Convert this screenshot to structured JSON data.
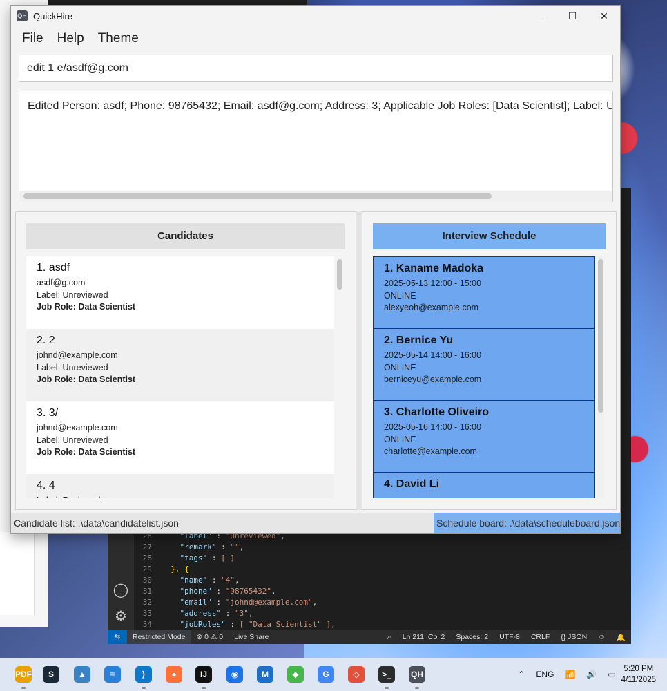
{
  "app": {
    "title": "QuickHire",
    "logo_text": "QH",
    "window_controls": {
      "minimize": "—",
      "maximize": "☐",
      "close": "✕"
    }
  },
  "menu": [
    "File",
    "Help",
    "Theme"
  ],
  "command_input": {
    "value": "edit 1 e/asdf@g.com"
  },
  "result": {
    "text": "Edited Person: asdf; Phone: 98765432; Email: asdf@g.com; Address: 3; Applicable Job Roles: [Data Scientist]; Label: Unreviewed"
  },
  "candidates": {
    "header": "Candidates",
    "items": [
      {
        "name": "1. asdf",
        "email": "asdf@g.com",
        "label": "Label: Unreviewed",
        "job": "Job Role: Data Scientist"
      },
      {
        "name": "2. 2",
        "email": "johnd@example.com",
        "label": "Label: Unreviewed",
        "job": "Job Role: Data Scientist"
      },
      {
        "name": "3. 3/",
        "email": "johnd@example.com",
        "label": "Label: Unreviewed",
        "job": "Job Role: Data Scientist"
      },
      {
        "name": "4. 4",
        "email": "",
        "label": "Label: Reviewed",
        "job": ""
      }
    ]
  },
  "schedule": {
    "header": "Interview Schedule",
    "items": [
      {
        "name": "1. Kaname Madoka",
        "time": "2025-05-13  12:00 - 15:00",
        "mode": "ONLINE",
        "email": "alexyeoh@example.com"
      },
      {
        "name": "2. Bernice Yu",
        "time": "2025-05-14  14:00 - 16:00",
        "mode": "ONLINE",
        "email": "berniceyu@example.com"
      },
      {
        "name": "3. Charlotte Oliveiro",
        "time": "2025-05-16  14:00 - 16:00",
        "mode": "ONLINE",
        "email": "charlotte@example.com"
      },
      {
        "name": "4. David Li",
        "time": "",
        "mode": "",
        "email": ""
      }
    ]
  },
  "status": {
    "left": "Candidate list: .\\data\\candidatelist.json",
    "right": "Schedule board: .\\data\\scheduleboard.json"
  },
  "vscode": {
    "code_lines": [
      {
        "n": "26",
        "key": "\"label\"",
        "val": "\"Unreviewed\"",
        "tail": ","
      },
      {
        "n": "27",
        "key": "\"remark\"",
        "val": "\"\"",
        "tail": ","
      },
      {
        "n": "28",
        "key": "\"tags\"",
        "val": "[ ]",
        "tail": ""
      },
      {
        "n": "29",
        "key": "",
        "val": "}, {",
        "tail": ""
      },
      {
        "n": "30",
        "key": "\"name\"",
        "val": "\"4\"",
        "tail": ","
      },
      {
        "n": "31",
        "key": "\"phone\"",
        "val": "\"98765432\"",
        "tail": ","
      },
      {
        "n": "32",
        "key": "\"email\"",
        "val": "\"johnd@example.com\"",
        "tail": ","
      },
      {
        "n": "33",
        "key": "\"address\"",
        "val": "\"3\"",
        "tail": ","
      },
      {
        "n": "34",
        "key": "\"jobRoles\"",
        "val": "[ \"Data Scientist\" ]",
        "tail": ","
      }
    ],
    "status": {
      "restricted": "Restricted Mode",
      "problems": "⊗ 0 ⚠ 0",
      "liveshare": "Live Share",
      "position": "Ln 211, Col 2",
      "spaces": "Spaces: 2",
      "encoding": "UTF-8",
      "eol": "CRLF",
      "language": "{} JSON"
    }
  },
  "taskbar": {
    "apps": [
      {
        "name": "pdf-app-icon",
        "glyph": "PDF",
        "color": "#e8a100"
      },
      {
        "name": "steam-icon",
        "glyph": "S",
        "color": "#1b2838"
      },
      {
        "name": "photos-icon",
        "glyph": "▲",
        "color": "#3b82c4"
      },
      {
        "name": "notepad-icon",
        "glyph": "≡",
        "color": "#2a7fd6"
      },
      {
        "name": "vscode-icon",
        "glyph": "⟩",
        "color": "#0e77c8"
      },
      {
        "name": "firefox-icon",
        "glyph": "●",
        "color": "#ff7139"
      },
      {
        "name": "intellij-icon",
        "glyph": "IJ",
        "color": "#111111"
      },
      {
        "name": "maps-icon",
        "glyph": "◉",
        "color": "#1a73e8"
      },
      {
        "name": "mail-icon",
        "glyph": "M",
        "color": "#1d6ec6"
      },
      {
        "name": "bluestacks-icon",
        "glyph": "◆",
        "color": "#45b649"
      },
      {
        "name": "chrome-icon",
        "glyph": "G",
        "color": "#4285f4"
      },
      {
        "name": "git-icon",
        "glyph": "◇",
        "color": "#e24f3b"
      },
      {
        "name": "terminal-icon",
        "glyph": ">_",
        "color": "#2b2b2b"
      },
      {
        "name": "quickhire-taskbar-icon",
        "glyph": "QH",
        "color": "#4a4f5a"
      }
    ],
    "tray": {
      "chevron": "⌃",
      "lang": "ENG",
      "wifi": "📶",
      "volume": "🔊",
      "battery": "▭"
    },
    "clock": {
      "time": "5:20 PM",
      "date": "4/11/2025"
    }
  }
}
